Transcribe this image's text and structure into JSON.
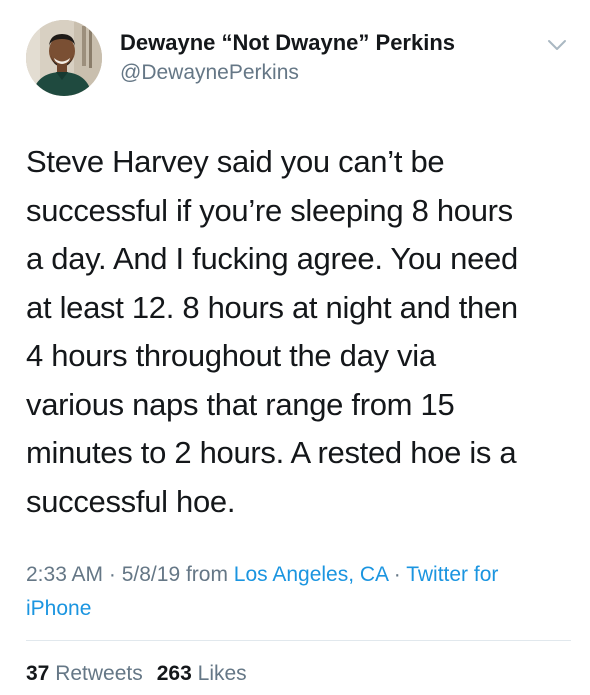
{
  "author": {
    "display_name": "Dewayne “Not Dwayne” Perkins",
    "handle": "@DewaynePerkins",
    "avatar_icon": "profile-photo"
  },
  "menu_icon": "chevron-down-icon",
  "tweet": {
    "lines": [
      "Steve Harvey said you can’t be",
      "successful if you’re sleeping 8 hours",
      "a day. And I fucking agree. You need",
      "at least 12. 8 hours at night and then",
      "4 hours throughout the day via",
      "various naps that range from 15",
      "minutes to 2 hours. A rested hoe is a",
      "successful hoe."
    ]
  },
  "meta": {
    "time": "2:33 AM",
    "sep1": " · ",
    "date": "5/8/19",
    "from_text": " from ",
    "location": "Los Angeles, CA",
    "sep2": " · ",
    "source": "Twitter for iPhone"
  },
  "stats": {
    "retweets_count": "37",
    "retweets_label": "Retweets",
    "likes_count": "263",
    "likes_label": "Likes"
  },
  "colors": {
    "text": "#14171a",
    "secondary": "#657786",
    "link": "#1b95e0",
    "divider": "#e1e8ed"
  }
}
